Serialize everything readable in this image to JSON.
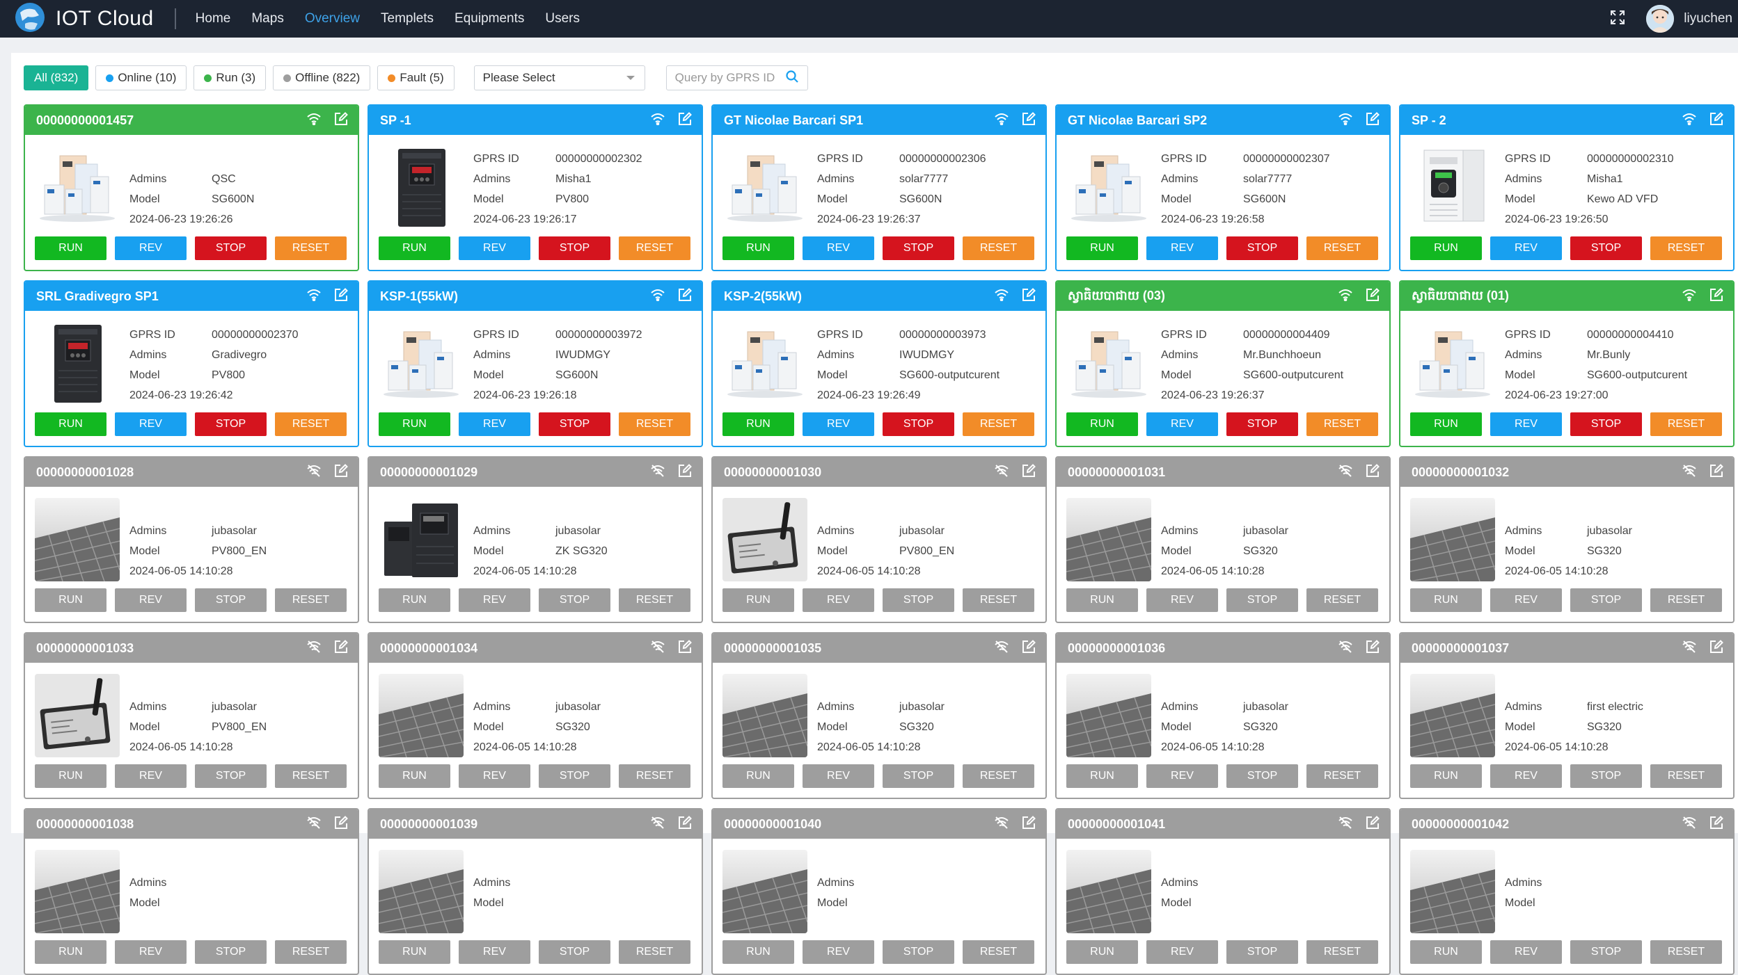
{
  "app": {
    "title": "IOT Cloud",
    "nav": [
      "Home",
      "Maps",
      "Overview",
      "Templets",
      "Equipments",
      "Users"
    ],
    "active_nav": "Overview",
    "username": "liyuchen"
  },
  "filters": {
    "buttons": [
      {
        "label": "All (832)",
        "dot": null
      },
      {
        "label": "Online (10)",
        "dot": "#18a0f0"
      },
      {
        "label": "Run (3)",
        "dot": "#3cb44b"
      },
      {
        "label": "Offline (822)",
        "dot": "#9e9e9e"
      },
      {
        "label": "Fault (5)",
        "dot": "#f28c28"
      }
    ],
    "select_placeholder": "Please Select",
    "search_placeholder": "Query by GPRS ID"
  },
  "labels": {
    "gprs": "GPRS ID",
    "admins": "Admins",
    "model": "Model",
    "run": "RUN",
    "rev": "REV",
    "stop": "STOP",
    "reset": "RESET"
  },
  "colors": {
    "run_status": "#3cb44b",
    "online_status": "#18a0f0",
    "offline_status": "#9e9e9e",
    "run_button": "#12b821",
    "rev_button": "#18a0f0",
    "stop_button": "#d5141e",
    "reset_button": "#f28c28"
  },
  "cards": [
    {
      "title": "00000000001457",
      "status": "green",
      "image": "inverter-family",
      "gprs": "",
      "admins": "QSC",
      "model": "SG600N",
      "time": "2024-06-23 19:26:26"
    },
    {
      "title": "SP -1",
      "status": "blue",
      "image": "dark-vfd",
      "gprs": "00000000002302",
      "admins": "Misha1",
      "model": "PV800",
      "time": "2024-06-23 19:26:17"
    },
    {
      "title": "GT Nicolae Barcari SP1",
      "status": "blue",
      "image": "inverter-family",
      "gprs": "00000000002306",
      "admins": "solar7777",
      "model": "SG600N",
      "time": "2024-06-23 19:26:37"
    },
    {
      "title": "GT Nicolae Barcari SP2",
      "status": "blue",
      "image": "inverter-family",
      "gprs": "00000000002307",
      "admins": "solar7777",
      "model": "SG600N",
      "time": "2024-06-23 19:26:58"
    },
    {
      "title": "SP - 2",
      "status": "blue",
      "image": "white-vfd",
      "gprs": "00000000002310",
      "admins": "Misha1",
      "model": "Kewo AD VFD",
      "time": "2024-06-23 19:26:50"
    },
    {
      "title": "SRL Gradivegro SP1",
      "status": "blue",
      "image": "dark-vfd",
      "gprs": "00000000002370",
      "admins": "Gradivegro",
      "model": "PV800",
      "time": "2024-06-23 19:26:42"
    },
    {
      "title": "KSP-1(55kW)",
      "status": "blue",
      "image": "inverter-family",
      "gprs": "00000000003972",
      "admins": "IWUDMGY",
      "model": "SG600N",
      "time": "2024-06-23 19:26:18"
    },
    {
      "title": "KSP-2(55kW)",
      "status": "blue",
      "image": "inverter-family",
      "gprs": "00000000003973",
      "admins": "IWUDMGY",
      "model": "SG600-outputcurent",
      "time": "2024-06-23 19:26:49"
    },
    {
      "title": "ស្វាធិយបាជាយ (03)",
      "status": "green",
      "image": "inverter-family",
      "gprs": "00000000004409",
      "admins": "Mr.Bunchhoeun",
      "model": "SG600-outputcurent",
      "time": "2024-06-23 19:26:37"
    },
    {
      "title": "ស្វាធិយបាជាយ (01)",
      "status": "green",
      "image": "inverter-family",
      "gprs": "00000000004410",
      "admins": "Mr.Bunly",
      "model": "SG600-outputcurent",
      "time": "2024-06-23 19:27:00"
    },
    {
      "title": "00000000001028",
      "status": "gray",
      "image": "solar-panel",
      "gprs": "",
      "admins": "jubasolar",
      "model": "PV800_EN",
      "time": "2024-06-05 14:10:28"
    },
    {
      "title": "00000000001029",
      "status": "gray",
      "image": "dark-vfd-pair",
      "gprs": "",
      "admins": "jubasolar",
      "model": "ZK SG320",
      "time": "2024-06-05 14:10:28"
    },
    {
      "title": "00000000001030",
      "status": "gray",
      "image": "gprs-box",
      "gprs": "",
      "admins": "jubasolar",
      "model": "PV800_EN",
      "time": "2024-06-05 14:10:28"
    },
    {
      "title": "00000000001031",
      "status": "gray",
      "image": "solar-panel",
      "gprs": "",
      "admins": "jubasolar",
      "model": "SG320",
      "time": "2024-06-05 14:10:28"
    },
    {
      "title": "00000000001032",
      "status": "gray",
      "image": "solar-panel",
      "gprs": "",
      "admins": "jubasolar",
      "model": "SG320",
      "time": "2024-06-05 14:10:28"
    },
    {
      "title": "00000000001033",
      "status": "gray",
      "image": "gprs-box",
      "gprs": "",
      "admins": "jubasolar",
      "model": "PV800_EN",
      "time": "2024-06-05 14:10:28"
    },
    {
      "title": "00000000001034",
      "status": "gray",
      "image": "solar-panel",
      "gprs": "",
      "admins": "jubasolar",
      "model": "SG320",
      "time": "2024-06-05 14:10:28"
    },
    {
      "title": "00000000001035",
      "status": "gray",
      "image": "solar-panel",
      "gprs": "",
      "admins": "jubasolar",
      "model": "SG320",
      "time": "2024-06-05 14:10:28"
    },
    {
      "title": "00000000001036",
      "status": "gray",
      "image": "solar-panel",
      "gprs": "",
      "admins": "jubasolar",
      "model": "SG320",
      "time": "2024-06-05 14:10:28"
    },
    {
      "title": "00000000001037",
      "status": "gray",
      "image": "solar-panel",
      "gprs": "",
      "admins": "first electric",
      "model": "SG320",
      "time": "2024-06-05 14:10:28"
    },
    {
      "title": "00000000001038",
      "status": "gray",
      "image": "solar-panel",
      "gprs": "",
      "admins": "",
      "model": "",
      "time": ""
    },
    {
      "title": "00000000001039",
      "status": "gray",
      "image": "solar-panel",
      "gprs": "",
      "admins": "",
      "model": "",
      "time": ""
    },
    {
      "title": "00000000001040",
      "status": "gray",
      "image": "solar-panel",
      "gprs": "",
      "admins": "",
      "model": "",
      "time": ""
    },
    {
      "title": "00000000001041",
      "status": "gray",
      "image": "solar-panel",
      "gprs": "",
      "admins": "",
      "model": "",
      "time": ""
    },
    {
      "title": "00000000001042",
      "status": "gray",
      "image": "solar-panel",
      "gprs": "",
      "admins": "",
      "model": "",
      "time": ""
    }
  ]
}
